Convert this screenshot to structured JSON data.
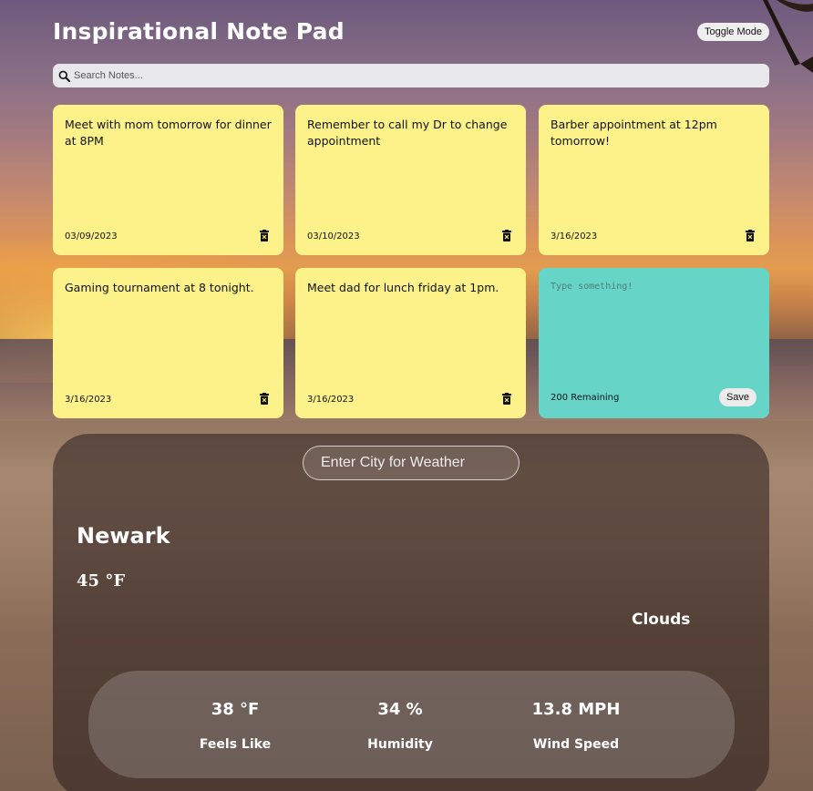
{
  "app": {
    "title": "Inspirational Note Pad",
    "toggle_label": "Toggle Mode"
  },
  "search": {
    "placeholder": "Search Notes..."
  },
  "notes": [
    {
      "text": "Meet with mom tomorrow for dinner at 8PM",
      "date": "03/09/2023"
    },
    {
      "text": "Remember to call my Dr to change appointment",
      "date": "03/10/2023"
    },
    {
      "text": "Barber appointment at 12pm tomorrow!",
      "date": "3/16/2023"
    },
    {
      "text": "Gaming tournament at 8 tonight.",
      "date": "3/16/2023"
    },
    {
      "text": "Meet dad for lunch friday at 1pm.",
      "date": "3/16/2023"
    }
  ],
  "new_note": {
    "placeholder": "Type something!",
    "remaining": "200 Remaining",
    "save_label": "Save"
  },
  "weather": {
    "city_placeholder": "Enter City for Weather",
    "city": "Newark",
    "temperature": "45 °F",
    "condition": "Clouds",
    "stats": [
      {
        "value": "38 °F",
        "label": "Feels Like"
      },
      {
        "value": "34 %",
        "label": "Humidity"
      },
      {
        "value": "13.8 MPH",
        "label": "Wind Speed"
      }
    ]
  },
  "colors": {
    "note_yellow": "#fdf28a",
    "new_note_teal": "#67d4c8"
  },
  "icons": {
    "search": "magnifier-icon",
    "delete": "trash-icon"
  }
}
